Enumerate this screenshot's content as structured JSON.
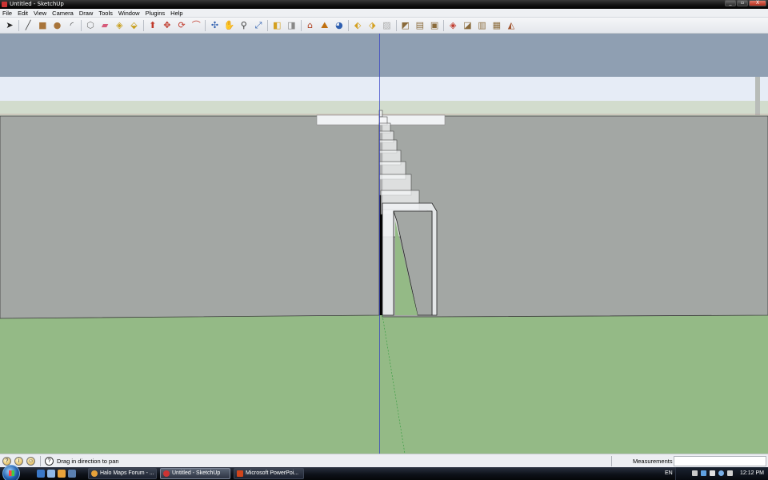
{
  "window": {
    "title": "Untitled - SketchUp",
    "controls": [
      "_",
      "▫",
      "X"
    ]
  },
  "menu": [
    "File",
    "Edit",
    "View",
    "Camera",
    "Draw",
    "Tools",
    "Window",
    "Plugins",
    "Help"
  ],
  "toolbar": {
    "groups": [
      [
        {
          "name": "select-tool-icon",
          "glyph": "➤",
          "color": "#222"
        }
      ],
      [
        {
          "name": "line-tool-icon",
          "glyph": "╱",
          "color": "#444"
        },
        {
          "name": "rectangle-tool-icon",
          "glyph": "■",
          "color": "#a8743a"
        },
        {
          "name": "circle-tool-icon",
          "glyph": "●",
          "color": "#a8743a"
        },
        {
          "name": "arc-tool-icon",
          "glyph": "◜",
          "color": "#444"
        }
      ],
      [
        {
          "name": "make-component-icon",
          "glyph": "⬡",
          "color": "#777"
        },
        {
          "name": "eraser-tool-icon",
          "glyph": "▰",
          "color": "#d65a7a"
        },
        {
          "name": "tape-measure-icon",
          "glyph": "◈",
          "color": "#c8a020"
        },
        {
          "name": "paint-bucket-icon",
          "glyph": "⬙",
          "color": "#c8a020"
        }
      ],
      [
        {
          "name": "push-pull-icon",
          "glyph": "⬆",
          "color": "#c0392b"
        },
        {
          "name": "move-tool-icon",
          "glyph": "✥",
          "color": "#c0392b"
        },
        {
          "name": "rotate-tool-icon",
          "glyph": "⟳",
          "color": "#c0392b"
        },
        {
          "name": "offset-tool-icon",
          "glyph": "⌒",
          "color": "#c0392b"
        }
      ],
      [
        {
          "name": "orbit-tool-icon",
          "glyph": "✣",
          "color": "#2f5fb0"
        },
        {
          "name": "pan-tool-icon",
          "glyph": "✋",
          "color": "#444"
        },
        {
          "name": "zoom-tool-icon",
          "glyph": "⚲",
          "color": "#333"
        },
        {
          "name": "zoom-extents-icon",
          "glyph": "⤢",
          "color": "#2f5fb0"
        }
      ],
      [
        {
          "name": "previous-view-icon",
          "glyph": "◧",
          "color": "#d4a020"
        },
        {
          "name": "next-view-icon",
          "glyph": "◨",
          "color": "#888"
        }
      ],
      [
        {
          "name": "add-location-icon",
          "glyph": "⌂",
          "color": "#b04020"
        },
        {
          "name": "toggle-terrain-icon",
          "glyph": "⛰",
          "color": "#c07010"
        },
        {
          "name": "get-models-icon",
          "glyph": "◕",
          "color": "#2f5fb0"
        }
      ],
      [
        {
          "name": "share-model-icon",
          "glyph": "⬖",
          "color": "#d4a020"
        },
        {
          "name": "share-component-icon",
          "glyph": "⬗",
          "color": "#d4a020"
        },
        {
          "name": "get-photo-texture-icon",
          "glyph": "▨",
          "color": "#aaa"
        }
      ],
      [
        {
          "name": "iso-view-icon",
          "glyph": "◩",
          "color": "#8a6a3a"
        },
        {
          "name": "top-view-icon",
          "glyph": "▤",
          "color": "#8a6a3a"
        },
        {
          "name": "front-view-icon",
          "glyph": "▣",
          "color": "#8a6a3a"
        }
      ],
      [
        {
          "name": "xray-style-icon",
          "glyph": "◈",
          "color": "#c0392b"
        },
        {
          "name": "wireframe-style-icon",
          "glyph": "◪",
          "color": "#8a6a3a"
        },
        {
          "name": "hidden-line-style-icon",
          "glyph": "▥",
          "color": "#8a6a3a"
        },
        {
          "name": "shaded-style-icon",
          "glyph": "▦",
          "color": "#8a6a3a"
        },
        {
          "name": "shaded-textures-style-icon",
          "glyph": "◭",
          "color": "#a0522d"
        }
      ]
    ]
  },
  "scene": {
    "sky": "#8f9fb2",
    "horizon_band": "#e6ecf6",
    "ground_far": "#d2dccd",
    "wall": "#a3a7a4",
    "grass": "#94ba86"
  },
  "statusbar": {
    "hint": "Drag in direction to pan",
    "measurements_label": "Measurements",
    "measurements_value": ""
  },
  "taskbar": {
    "tasks": [
      {
        "label": "Halo Maps Forum - ...",
        "color": "#e8a23a",
        "active": false
      },
      {
        "label": "Untitled - SketchUp",
        "color": "#c33",
        "active": true
      },
      {
        "label": "Microsoft PowerPoi...",
        "color": "#d0451b",
        "active": false
      }
    ],
    "lang": "EN",
    "clock": "12:12 PM"
  }
}
